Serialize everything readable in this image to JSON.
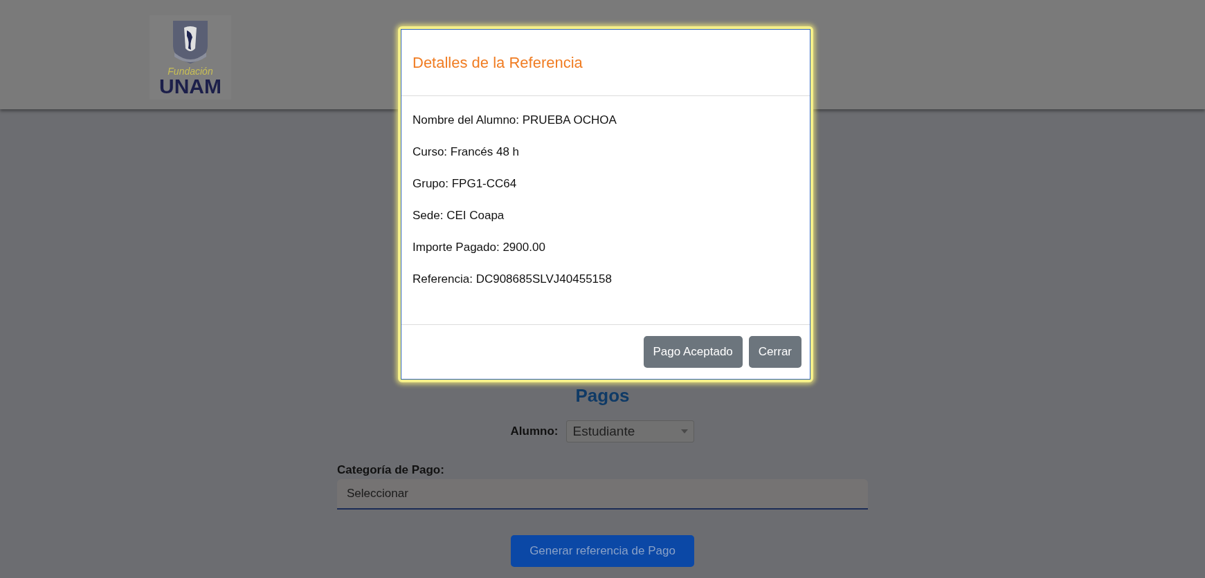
{
  "logo": {
    "subtitle": "Fundación",
    "name": "UNAM"
  },
  "page": {
    "title": "Pagos",
    "student_label": "Alumno:",
    "student_select": "Estudiante",
    "category_label": "Categoría de Pago:",
    "category_select": "Seleccionar",
    "generate_button": "Generar referencia de Pago"
  },
  "modal": {
    "title": "Detalles de la Referencia",
    "details": [
      "Nombre del Alumno: PRUEBA OCHOA",
      "Curso: Francés 48 h",
      "Grupo: FPG1-CC64",
      "Sede: CEI Coapa",
      "Importe Pagado: 2900.00",
      "Referencia: DC908685SLVJ40455158"
    ],
    "buttons": [
      "Pago Aceptado",
      "Cerrar"
    ]
  }
}
